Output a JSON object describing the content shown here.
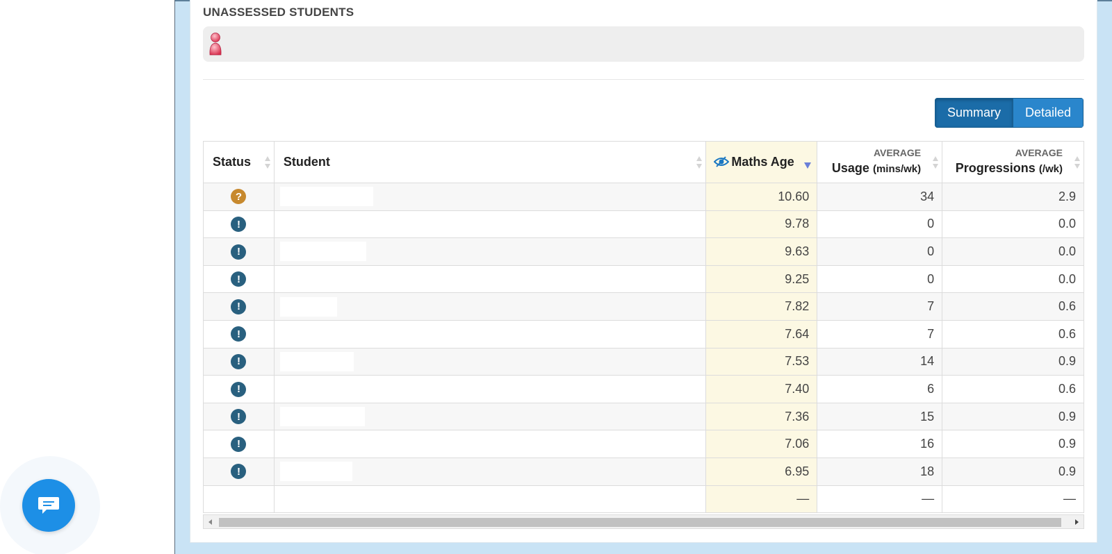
{
  "unassessed": {
    "title": "UNASSESSED STUDENTS"
  },
  "view_toggle": {
    "summary_label": "Summary",
    "detailed_label": "Detailed",
    "active": "Summary"
  },
  "table": {
    "headers": {
      "status": "Status",
      "student": "Student",
      "maths_age": "Maths Age",
      "usage_over": "AVERAGE",
      "usage_main": "Usage",
      "usage_unit": "(mins/wk)",
      "progressions_over": "AVERAGE",
      "progressions_main": "Progressions",
      "progressions_unit": "(/wk)"
    },
    "sorted_column": "maths_age",
    "sort_direction": "descending",
    "rows": [
      {
        "status": "?",
        "status_type": "unknown",
        "maths_age": "10.60",
        "usage": "34",
        "progressions": "2.9"
      },
      {
        "status": "!",
        "status_type": "warning",
        "maths_age": "9.78",
        "usage": "0",
        "progressions": "0.0"
      },
      {
        "status": "!",
        "status_type": "warning",
        "maths_age": "9.63",
        "usage": "0",
        "progressions": "0.0"
      },
      {
        "status": "!",
        "status_type": "warning",
        "maths_age": "9.25",
        "usage": "0",
        "progressions": "0.0"
      },
      {
        "status": "!",
        "status_type": "warning",
        "maths_age": "7.82",
        "usage": "7",
        "progressions": "0.6"
      },
      {
        "status": "!",
        "status_type": "warning",
        "maths_age": "7.64",
        "usage": "7",
        "progressions": "0.6"
      },
      {
        "status": "!",
        "status_type": "warning",
        "maths_age": "7.53",
        "usage": "14",
        "progressions": "0.9"
      },
      {
        "status": "!",
        "status_type": "warning",
        "maths_age": "7.40",
        "usage": "6",
        "progressions": "0.6"
      },
      {
        "status": "!",
        "status_type": "warning",
        "maths_age": "7.36",
        "usage": "15",
        "progressions": "0.9"
      },
      {
        "status": "!",
        "status_type": "warning",
        "maths_age": "7.06",
        "usage": "16",
        "progressions": "0.9"
      },
      {
        "status": "!",
        "status_type": "warning",
        "maths_age": "6.95",
        "usage": "18",
        "progressions": "0.9"
      },
      {
        "status": "",
        "status_type": "none",
        "maths_age": "—",
        "usage": "—",
        "progressions": "—"
      }
    ]
  },
  "colors": {
    "frame": "#c9e3f5",
    "button_active": "#1b6ca8",
    "button": "#2a86cc",
    "highlight_column": "#fcf8e3",
    "status_warning": "#29607f",
    "status_unknown": "#c7892e",
    "chat": "#1d8fe6"
  },
  "icons": {
    "unassessed_student": "person-icon",
    "maths_age_header": "eye-icon",
    "chat": "chat-icon"
  }
}
